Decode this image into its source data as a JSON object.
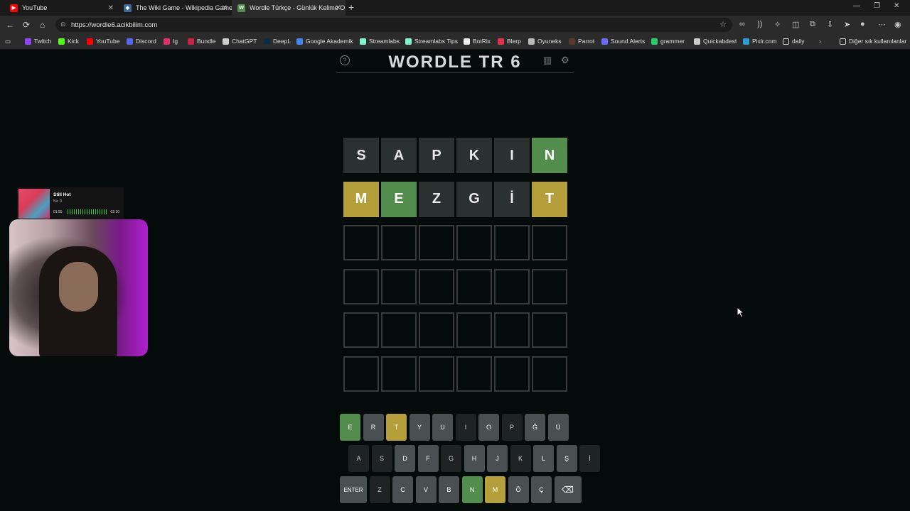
{
  "browser": {
    "tabs": [
      {
        "title": "YouTube",
        "icon_color": "#ff0000"
      },
      {
        "title": "The Wiki Game - Wikipedia Game",
        "icon_color": "#e0e0e0"
      },
      {
        "title": "Wordle Türkçe - Günlük Kelime O",
        "icon_color": "#538d4e",
        "icon_letter": "W"
      }
    ],
    "url": "https://wordle6.acikbilim.com",
    "bookmarks": [
      {
        "label": "Twitch",
        "color": "#9146ff"
      },
      {
        "label": "Kick",
        "color": "#53fc18"
      },
      {
        "label": "YouTube",
        "color": "#ff0000"
      },
      {
        "label": "Discord",
        "color": "#5865f2"
      },
      {
        "label": "Ig",
        "color": "#e1306c"
      },
      {
        "label": "Bundle",
        "color": "#cc2244"
      },
      {
        "label": "ChatGPT",
        "color": "#cfcfcf"
      },
      {
        "label": "DeepL",
        "color": "#0f2b46"
      },
      {
        "label": "Google Akademik",
        "color": "#4285f4"
      },
      {
        "label": "Streamlabs",
        "color": "#80f5d2"
      },
      {
        "label": "Streamlabs Tips",
        "color": "#80f5d2"
      },
      {
        "label": "BotRix",
        "color": "#eeeeee"
      },
      {
        "label": "Blerp",
        "color": "#e8324a"
      },
      {
        "label": "Oyuneks",
        "color": "#bbbbbb"
      },
      {
        "label": "Parrot",
        "color": "#5a3a2a"
      },
      {
        "label": "Sound Alerts",
        "color": "#6a6aff"
      },
      {
        "label": "grammer",
        "color": "#2ecc71"
      },
      {
        "label": "Quickabdest",
        "color": "#cccccc"
      },
      {
        "label": "Pixlr.com",
        "color": "#2d9cdb"
      },
      {
        "label": "daily",
        "color": "#cfcfcf"
      }
    ],
    "bookmarks_other": "Diğer sık kullanılanlar"
  },
  "game": {
    "title": "WORDLE TR 6",
    "rows": [
      [
        {
          "l": "S",
          "s": "absent"
        },
        {
          "l": "A",
          "s": "absent"
        },
        {
          "l": "P",
          "s": "absent"
        },
        {
          "l": "K",
          "s": "absent"
        },
        {
          "l": "I",
          "s": "absent"
        },
        {
          "l": "N",
          "s": "correct"
        }
      ],
      [
        {
          "l": "M",
          "s": "present"
        },
        {
          "l": "E",
          "s": "correct"
        },
        {
          "l": "Z",
          "s": "absent"
        },
        {
          "l": "G",
          "s": "absent"
        },
        {
          "l": "İ",
          "s": "absent"
        },
        {
          "l": "T",
          "s": "present"
        }
      ],
      [
        {
          "l": "",
          "s": "empty"
        },
        {
          "l": "",
          "s": "empty"
        },
        {
          "l": "",
          "s": "empty"
        },
        {
          "l": "",
          "s": "empty"
        },
        {
          "l": "",
          "s": "empty"
        },
        {
          "l": "",
          "s": "empty"
        }
      ],
      [
        {
          "l": "",
          "s": "empty"
        },
        {
          "l": "",
          "s": "empty"
        },
        {
          "l": "",
          "s": "empty"
        },
        {
          "l": "",
          "s": "empty"
        },
        {
          "l": "",
          "s": "empty"
        },
        {
          "l": "",
          "s": "empty"
        }
      ],
      [
        {
          "l": "",
          "s": "empty"
        },
        {
          "l": "",
          "s": "empty"
        },
        {
          "l": "",
          "s": "empty"
        },
        {
          "l": "",
          "s": "empty"
        },
        {
          "l": "",
          "s": "empty"
        },
        {
          "l": "",
          "s": "empty"
        }
      ],
      [
        {
          "l": "",
          "s": "empty"
        },
        {
          "l": "",
          "s": "empty"
        },
        {
          "l": "",
          "s": "empty"
        },
        {
          "l": "",
          "s": "empty"
        },
        {
          "l": "",
          "s": "empty"
        },
        {
          "l": "",
          "s": "empty"
        }
      ]
    ],
    "keyboard": [
      [
        {
          "k": "E",
          "s": "correct"
        },
        {
          "k": "R",
          "s": "unused"
        },
        {
          "k": "T",
          "s": "present"
        },
        {
          "k": "Y",
          "s": "unused"
        },
        {
          "k": "U",
          "s": "unused"
        },
        {
          "k": "I",
          "s": "used"
        },
        {
          "k": "O",
          "s": "unused"
        },
        {
          "k": "P",
          "s": "used"
        },
        {
          "k": "Ğ",
          "s": "unused"
        },
        {
          "k": "Ü",
          "s": "unused"
        }
      ],
      [
        {
          "k": "A",
          "s": "used"
        },
        {
          "k": "S",
          "s": "used"
        },
        {
          "k": "D",
          "s": "unused"
        },
        {
          "k": "F",
          "s": "unused"
        },
        {
          "k": "G",
          "s": "used"
        },
        {
          "k": "H",
          "s": "unused"
        },
        {
          "k": "J",
          "s": "unused"
        },
        {
          "k": "K",
          "s": "used"
        },
        {
          "k": "L",
          "s": "unused"
        },
        {
          "k": "Ş",
          "s": "unused"
        },
        {
          "k": "İ",
          "s": "used"
        }
      ],
      [
        {
          "k": "ENTER",
          "s": "unused",
          "wide": true
        },
        {
          "k": "Z",
          "s": "used"
        },
        {
          "k": "C",
          "s": "unused"
        },
        {
          "k": "V",
          "s": "unused"
        },
        {
          "k": "B",
          "s": "unused"
        },
        {
          "k": "N",
          "s": "correct"
        },
        {
          "k": "M",
          "s": "present"
        },
        {
          "k": "Ö",
          "s": "unused"
        },
        {
          "k": "Ç",
          "s": "unused"
        },
        {
          "k": "⌫",
          "s": "unused",
          "wide": true
        }
      ]
    ]
  },
  "spotify": {
    "title": "Still Hot",
    "artist": "Nic D",
    "elapsed": "01:55",
    "duration": "02:10",
    "progress": 0.86
  },
  "icons": {
    "help": "?",
    "stats": "▥",
    "settings": "⚙",
    "back": "←",
    "refresh": "⟳",
    "home": "⌂",
    "star": "☆",
    "lock": "⊙"
  }
}
